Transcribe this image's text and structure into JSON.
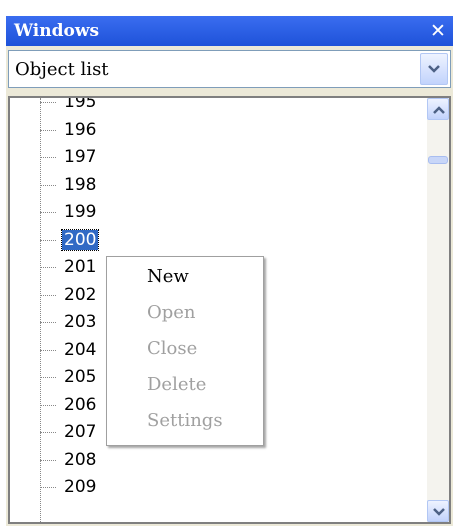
{
  "window": {
    "title": "Windows",
    "close_glyph": "✕"
  },
  "selector": {
    "value": "Object list"
  },
  "tree": {
    "items": [
      {
        "label": "195"
      },
      {
        "label": "196"
      },
      {
        "label": "197"
      },
      {
        "label": "198"
      },
      {
        "label": "199"
      },
      {
        "label": "200",
        "selected": true
      },
      {
        "label": "201"
      },
      {
        "label": "202"
      },
      {
        "label": "203"
      },
      {
        "label": "204"
      },
      {
        "label": "205"
      },
      {
        "label": "206"
      },
      {
        "label": "207"
      },
      {
        "label": "208"
      },
      {
        "label": "209"
      }
    ]
  },
  "context_menu": {
    "items": [
      {
        "label": "New",
        "enabled": true
      },
      {
        "label": "Open",
        "enabled": false
      },
      {
        "label": "Close",
        "enabled": false
      },
      {
        "label": "Delete",
        "enabled": false
      },
      {
        "label": "Settings",
        "enabled": false
      }
    ]
  },
  "colors": {
    "titlebar": "#1e52d9",
    "selection": "#316ac5",
    "disabled_text": "#a0a0a0"
  }
}
